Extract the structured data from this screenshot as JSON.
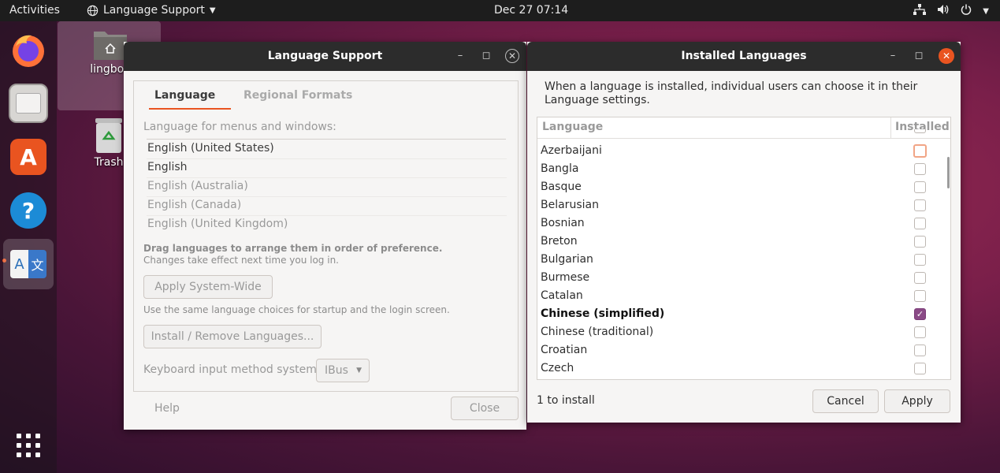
{
  "topbar": {
    "activities": "Activities",
    "app_menu": "Language Support",
    "clock": "Dec 27  07:14"
  },
  "desktop": {
    "home_label": "lingboe",
    "trash_label": "Trash"
  },
  "language_support": {
    "title": "Language Support",
    "tabs": [
      "Language",
      "Regional Formats"
    ],
    "menus_label": "Language for menus and windows:",
    "languages": [
      {
        "name": "English (United States)",
        "active": true
      },
      {
        "name": "English",
        "active": true
      },
      {
        "name": "English (Australia)",
        "active": false
      },
      {
        "name": "English (Canada)",
        "active": false
      },
      {
        "name": "English (United Kingdom)",
        "active": false
      }
    ],
    "drag_hint": "Drag languages to arrange them in order of preference.",
    "drag_hint2": "Changes take effect next time you log in.",
    "apply_system_wide": "Apply System-Wide",
    "apply_hint": "Use the same language choices for startup and the login screen.",
    "install_remove": "Install / Remove Languages...",
    "keyboard_label": "Keyboard input method system:",
    "keyboard_value": "IBus",
    "help": "Help",
    "close": "Close"
  },
  "installed_languages": {
    "title": "Installed Languages",
    "intro": "When a language is installed, individual users can choose it in their Language settings.",
    "col_language": "Language",
    "col_installed": "Installed",
    "rows": [
      {
        "name": "Azerbaijani",
        "checked": false,
        "focus": true
      },
      {
        "name": "Bangla",
        "checked": false
      },
      {
        "name": "Basque",
        "checked": false
      },
      {
        "name": "Belarusian",
        "checked": false
      },
      {
        "name": "Bosnian",
        "checked": false
      },
      {
        "name": "Breton",
        "checked": false
      },
      {
        "name": "Bulgarian",
        "checked": false
      },
      {
        "name": "Burmese",
        "checked": false
      },
      {
        "name": "Catalan",
        "checked": false
      },
      {
        "name": "Chinese (simplified)",
        "checked": true,
        "bold": true
      },
      {
        "name": "Chinese (traditional)",
        "checked": false
      },
      {
        "name": "Croatian",
        "checked": false
      },
      {
        "name": "Czech",
        "checked": false
      }
    ],
    "status": "1 to install",
    "cancel": "Cancel",
    "apply": "Apply"
  }
}
